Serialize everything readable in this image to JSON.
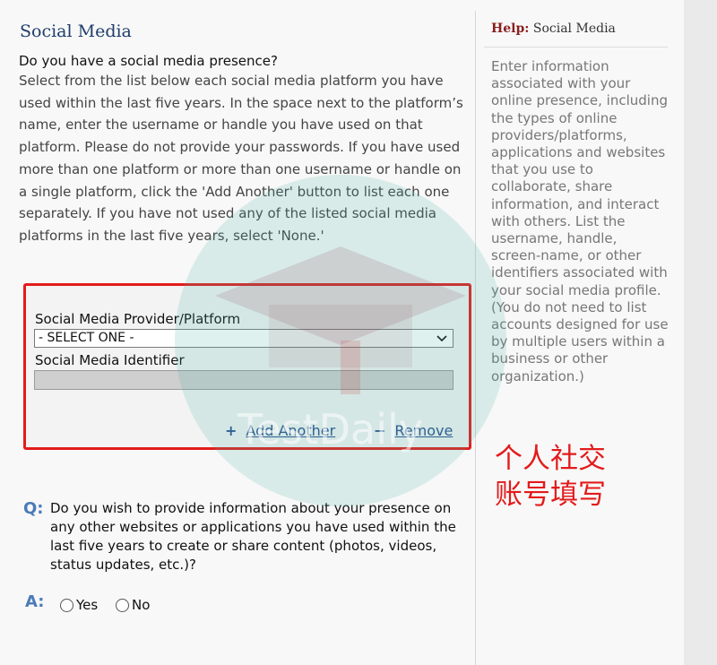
{
  "main": {
    "section_title": "Social Media",
    "question": "Do you have a social media presence?",
    "instructions": "Select from the list below each social media platform you have used within the last five years. In the space next to the platform’s name, enter the username or handle you have used on that platform. Please do not provide your passwords. If you have used more than one platform or more than one username or handle on a single platform, click the 'Add Another' button to list each one separately. If you have not used any of the listed social media platforms in the last five years, select 'None.'",
    "form": {
      "provider_label": "Social Media Provider/Platform",
      "provider_selected": "- SELECT ONE -",
      "identifier_label": "Social Media Identifier",
      "identifier_value": "",
      "add_symbol": "+",
      "add_label": "Add Another",
      "remove_symbol": "−",
      "remove_label": "Remove"
    },
    "followup": {
      "q_marker": "Q:",
      "question": "Do you wish to provide information about your presence on any other websites or applications you have used within the last five years to create or share content (photos, videos, status updates, etc.)?",
      "a_marker": "A:",
      "yes_label": "Yes",
      "no_label": "No"
    }
  },
  "help": {
    "title_lead": "Help:",
    "title_topic": "Social Media",
    "body": "Enter information associated with your online presence, including the types of online providers/platforms, applications and websites that you use to collaborate, share information, and interact with others. List the username, handle, screen-name, or other identifiers associated with your social media profile. (You do not need to list accounts designed for use by multiple users within a business or other organization.)"
  },
  "annotation": {
    "line1": "个人社交",
    "line2": "账号填写",
    "color": "#e31b1b"
  },
  "watermark": {
    "text": "TestDaily"
  },
  "colors": {
    "highlight_border": "#e31b1b",
    "link": "#2a4f8f",
    "marker": "#4a7bb7",
    "help_title": "#8a1f1f"
  }
}
